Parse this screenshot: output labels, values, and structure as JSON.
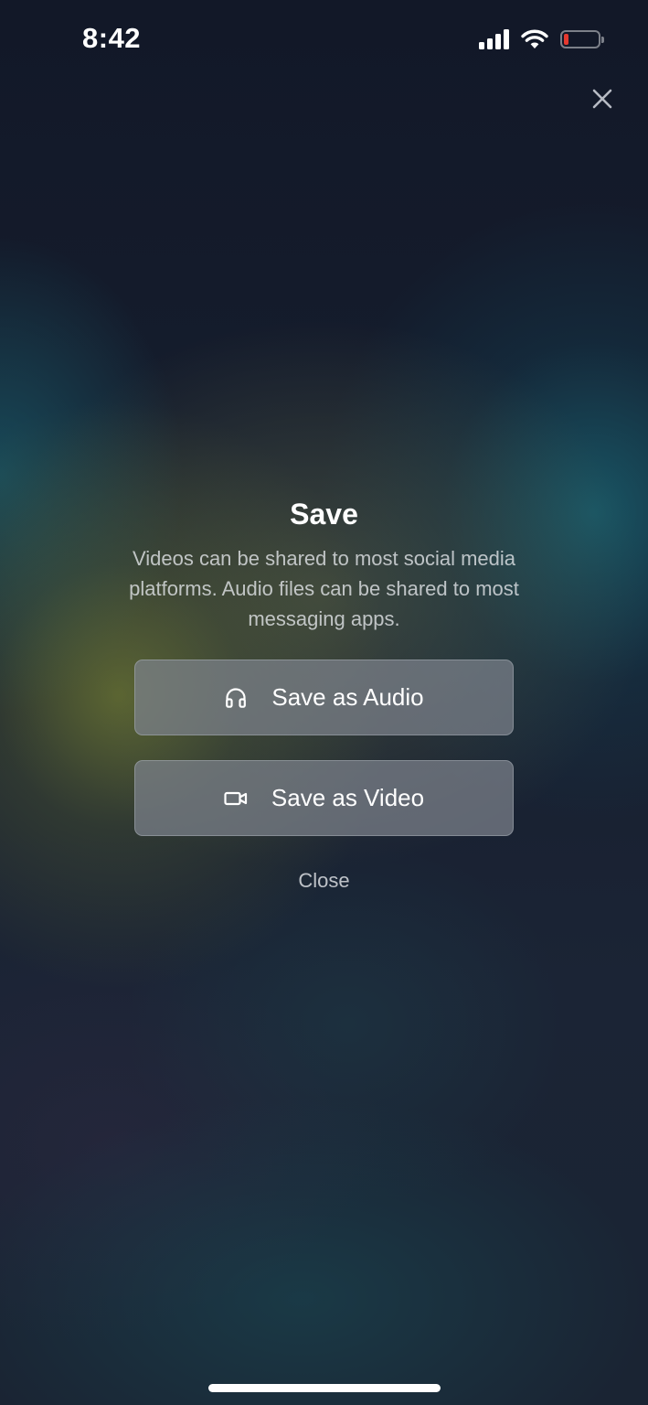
{
  "status_bar": {
    "time": "8:42",
    "battery_color": "#e5392f"
  },
  "icons": {
    "close": "close-icon",
    "audio": "headphones-icon",
    "video": "video-camera-icon"
  },
  "dialog": {
    "title": "Save",
    "description": "Videos can be shared to most social media platforms. Audio files can be shared to most messaging apps.",
    "audio_button_label": "Save as Audio",
    "video_button_label": "Save as Video",
    "close_label": "Close"
  }
}
